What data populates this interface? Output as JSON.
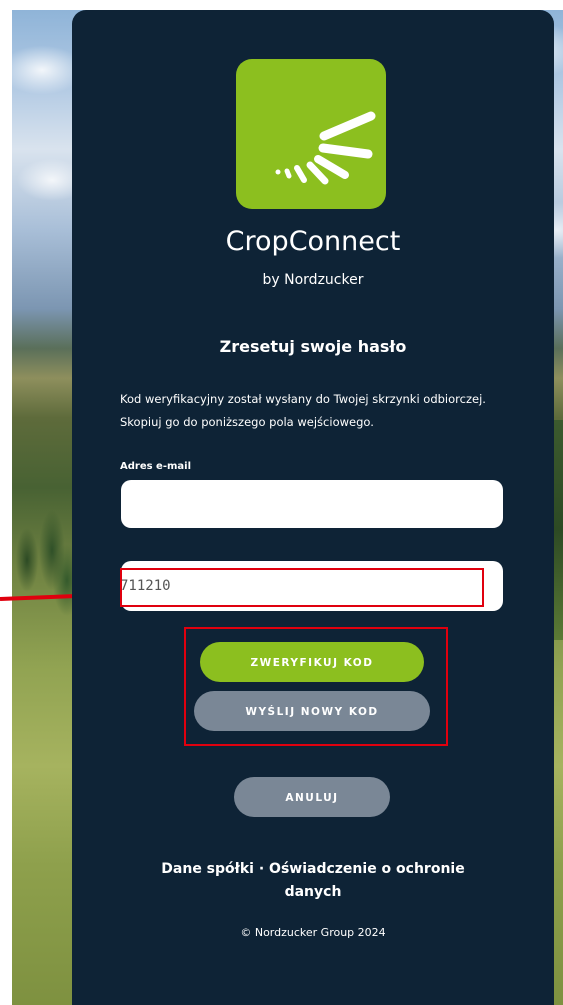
{
  "brand": {
    "app_name": "CropConnect",
    "app_sub": "by Nordzucker",
    "accent": "#8cbf1f",
    "card_bg": "#0e2336",
    "logo_icon": "sun-rays-logo-icon"
  },
  "form": {
    "heading": "Zresetuj swoje hasło",
    "info": "Kod weryfikacyjny został wysłany do Twojej skrzynki odbiorczej. Skopiuj go do poniższego pola wejściowego.",
    "email_label": "Adres e-mail",
    "email_value": "",
    "code_value": "711210"
  },
  "buttons": {
    "verify": "ZWERYFIKUJ KOD",
    "resend": "WYŚLIJ NOWY KOD",
    "cancel": "ANULUJ"
  },
  "footer": {
    "company_link": "Dane spółki",
    "separator": "·",
    "privacy_link": "Oświadczenie o ochronie danych",
    "copyright": "© Nordzucker Group 2024"
  },
  "annotations": {
    "highlight_color": "#e0000e",
    "arrow_color": "#e0000e"
  }
}
